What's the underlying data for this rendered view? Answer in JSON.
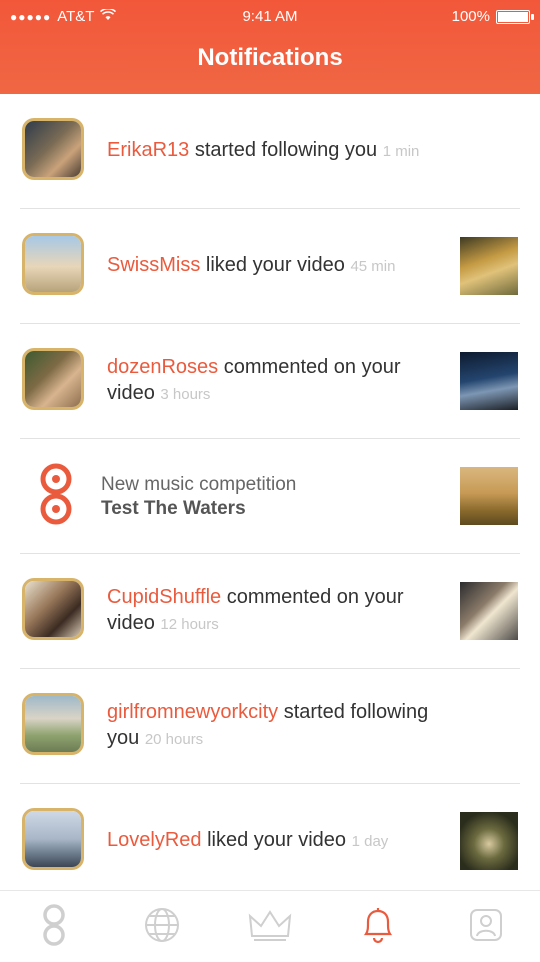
{
  "status_bar": {
    "carrier": "AT&T",
    "time": "9:41 AM",
    "battery": "100%"
  },
  "header": {
    "title": "Notifications"
  },
  "notifications": [
    {
      "username": "ErikaR13",
      "action": "started following you",
      "time": "1 min"
    },
    {
      "username": "SwissMiss",
      "action": "liked your video",
      "time": "45 min"
    },
    {
      "username": "dozenRoses",
      "action": "commented on your video",
      "time": "3 hours"
    },
    {
      "title": "New music competition",
      "subtitle": "Test The Waters"
    },
    {
      "username": "CupidShuffle",
      "action": "commented on your video",
      "time": "12 hours"
    },
    {
      "username": "girlfromnewyorkcity",
      "action": "started following you",
      "time": "20 hours"
    },
    {
      "username": "LovelyRed",
      "action": "liked your video",
      "time": "1 day"
    }
  ],
  "tab_bar": {
    "tabs": [
      "home-logo-icon",
      "globe-icon",
      "crown-icon",
      "bell-icon",
      "profile-icon"
    ],
    "active": "bell-icon",
    "active_color": "#ea5b3e",
    "inactive_color": "#cfcfcf"
  },
  "colors": {
    "header": "#f2573a",
    "username": "#ea5b3e",
    "time": "#c7c7c7",
    "avatar_border": "#d7b46a"
  }
}
